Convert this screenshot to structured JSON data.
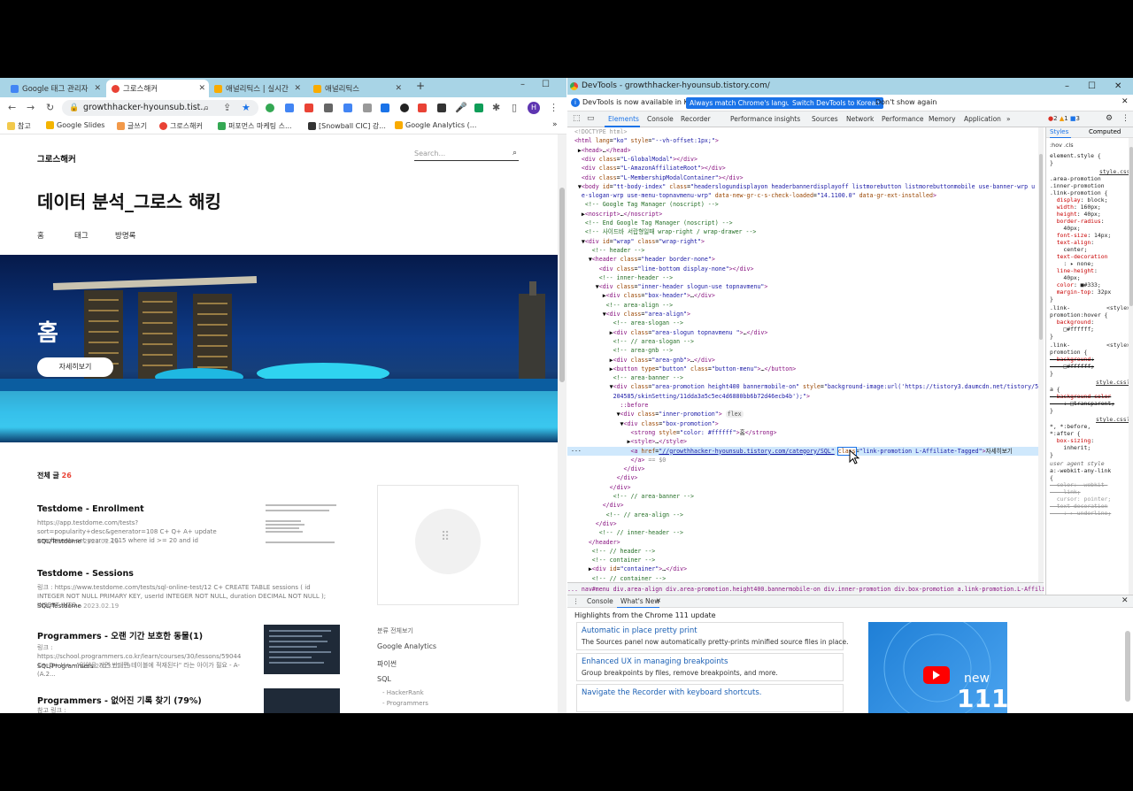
{
  "browser": {
    "tabs": [
      {
        "label": "Google 태그 관리자",
        "color": "#4285f4"
      },
      {
        "label": "그로스해커",
        "color": "#e94235"
      },
      {
        "label": "애널리틱스 | 실시간",
        "color": "#f9ab00"
      },
      {
        "label": "애널리틱스",
        "color": "#f9ab00"
      }
    ],
    "url": "growthhacker-hyounsub.tist...",
    "bookmarks": [
      {
        "label": "참고",
        "color": "#f2c94c"
      },
      {
        "label": "Google Slides",
        "color": "#f4b400"
      },
      {
        "label": "글쓰기",
        "color": "#f2994a"
      },
      {
        "label": "그로스해커",
        "color": "#e94235"
      },
      {
        "label": "퍼포먼스 마케팅 스...",
        "color": "#34a853"
      },
      {
        "label": "[Snowball CIC] 강...",
        "color": "#333333"
      },
      {
        "label": "Google Analytics (...",
        "color": "#f9ab00"
      }
    ],
    "profile_initial": "H"
  },
  "blog": {
    "brand": "그로스해커",
    "search_placeholder": "Search...",
    "title": "데이터 분석_그로스 해킹",
    "nav": [
      "홈",
      "태그",
      "방명록"
    ],
    "hero_heading": "홈",
    "hero_button": "자세히보기",
    "all_posts_label": "전체 글",
    "all_posts_count": "26",
    "posts": [
      {
        "title": "Testdome - Enrollment",
        "body": "https://app.testdome.com/tests?sort=popularity+desc&generator=108 C+ Q+ A+ update enrollments set year = 2015 where id >= 20 and id",
        "category": "SQL/Testdome",
        "date": "2023.02.19"
      },
      {
        "title": "Testdome - Sessions",
        "body": "링크 : https://www.testdome.com/tests/sql-online-test/12 C+ CREATE TABLE sessions ( id INTEGER NOT NULL PRIMARY KEY, userId INTEGER NOT NULL, duration DECIMAL NOT NULL ); INSERT INTO...",
        "category": "SQL/Testdome",
        "date": "2023.02.19"
      },
      {
        "title": "Programmers - 오랜 기간 보호한 동물(1)",
        "body": "링크 : https://school.programmers.co.kr/learn/courses/30/lessons/59044 C+ Q+ H+ - \"입양을 가면 반대편 테이블에 적재된다\" 라는 아이가 필요 - A- (A.2...",
        "category": "SQL/Programmers",
        "date": "2023.02.19"
      },
      {
        "title": "Programmers - 없어진 기록 찾기 (79%)",
        "body": "참고 링크 :",
        "category": "",
        "date": ""
      }
    ],
    "sidebar_categories": [
      "분류 전체보기",
      "Google Analytics",
      "파이썬",
      "SQL",
      "- HackerRank",
      "- Programmers"
    ]
  },
  "devtools": {
    "title": "DevTools - growthhacker-hyounsub.tistory.com/",
    "info_text": "DevTools is now available in Korean!",
    "btn_match": "Always match Chrome's language",
    "btn_switch": "Switch DevTools to Korean",
    "btn_dismiss": "Don't show again",
    "tabs": [
      "Elements",
      "Console",
      "Recorder",
      "Performance insights",
      "Sources",
      "Network",
      "Performance",
      "Memory",
      "Application"
    ],
    "badges": {
      "errors": "2",
      "warnings": "1",
      "info": "3"
    },
    "breadcrumbs": "... nav#menu   div.area-align   div.area-promotion.height400.bannermobile-on   div.inner-promotion   div.box-promotion   a.link-promotion.L-Affiliate-Tagged",
    "styles_tabs": [
      "Styles",
      "Computed"
    ],
    "styles_filter": ":hov .cls",
    "drawer_tabs": [
      "Console",
      "What's New"
    ],
    "whats_new_heading": "Highlights from the Chrome 111 update",
    "whats_new": [
      {
        "title": "Automatic in place pretty print",
        "desc": "The Sources panel now automatically pretty-prints minified source files in place."
      },
      {
        "title": "Enhanced UX in managing breakpoints",
        "desc": "Group breakpoints by files, remove breakpoints, and more."
      },
      {
        "title": "Navigate the Recorder with keyboard shortcuts.",
        "desc": ""
      }
    ],
    "promo_new": "new",
    "promo_version": "111"
  }
}
